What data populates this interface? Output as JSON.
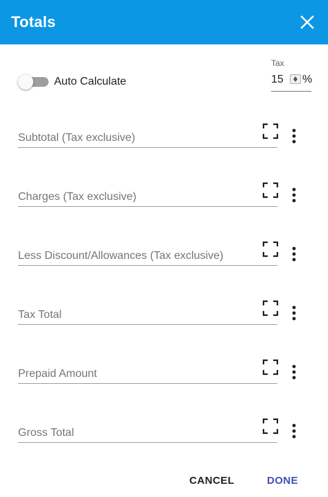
{
  "dialog": {
    "title": "Totals",
    "close_icon": "close-icon"
  },
  "auto_calculate": {
    "label": "Auto Calculate",
    "enabled": false
  },
  "tax": {
    "label": "Tax",
    "value": "15",
    "unit": "%"
  },
  "fields": [
    {
      "label": "Subtotal (Tax exclusive)",
      "value": ""
    },
    {
      "label": "Charges (Tax exclusive)",
      "value": ""
    },
    {
      "label": "Less Discount/Allowances (Tax exclusive)",
      "value": ""
    },
    {
      "label": "Tax Total",
      "value": ""
    },
    {
      "label": "Prepaid Amount",
      "value": ""
    },
    {
      "label": "Gross Total",
      "value": ""
    }
  ],
  "actions": {
    "cancel": "CANCEL",
    "done": "DONE"
  },
  "colors": {
    "header": "#0b97e3",
    "done": "#3f51b5",
    "toggle_track": "#9e9e9e"
  }
}
